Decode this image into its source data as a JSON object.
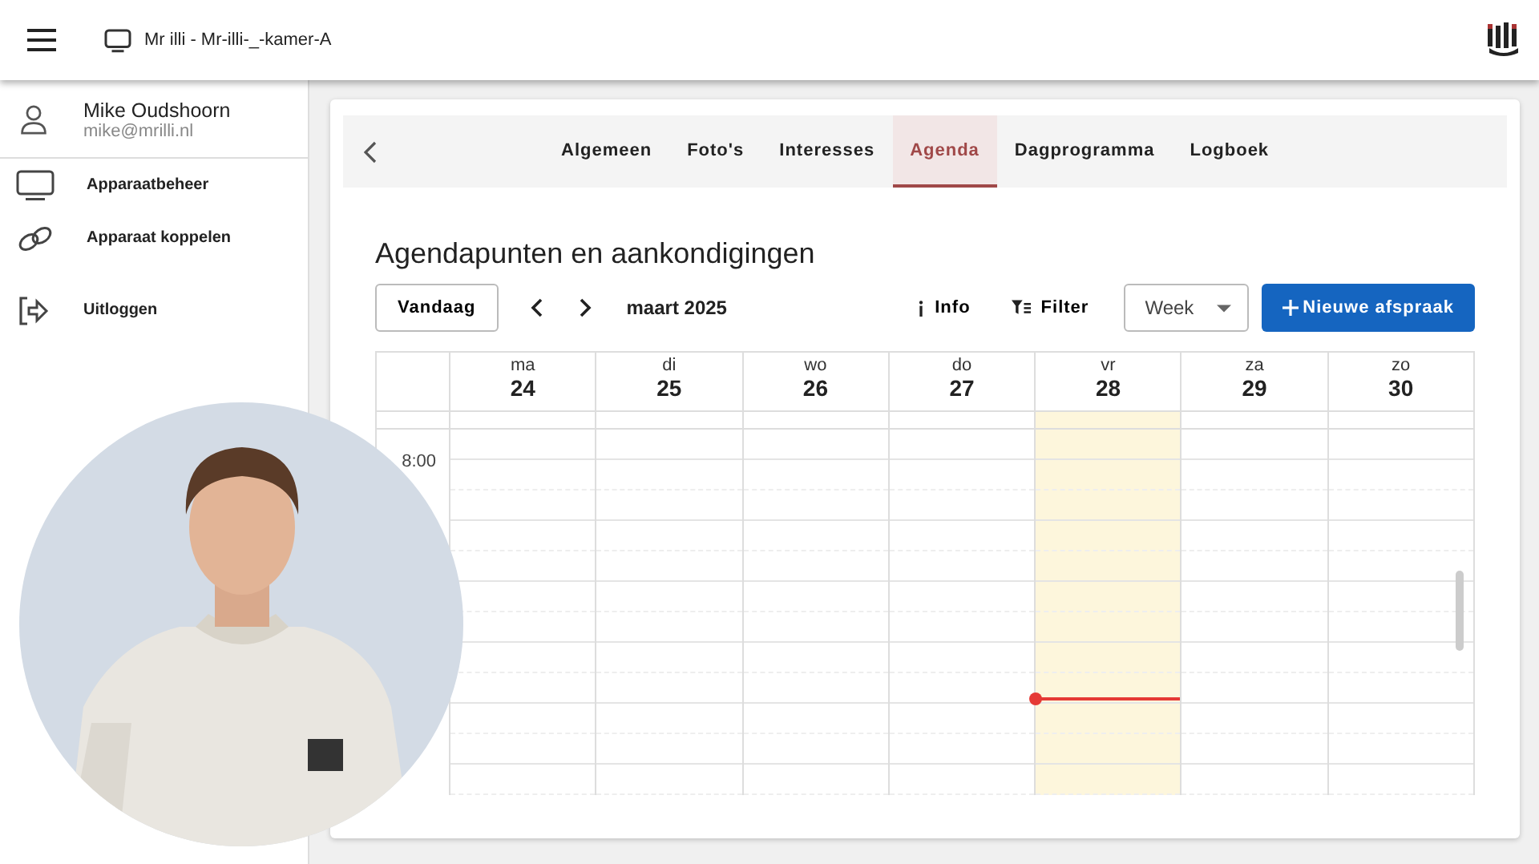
{
  "app_bar": {
    "device": "Mr illi - Mr-illi-_-kamer-A"
  },
  "user": {
    "name": "Mike Oudshoorn",
    "email": "mike@mrilli.nl"
  },
  "sidebar": {
    "items": [
      {
        "label": "Apparaatbeheer",
        "kind": "monitor"
      },
      {
        "label": "Apparaat koppelen",
        "kind": "link"
      },
      {
        "label": "Uitloggen",
        "kind": "logout"
      }
    ]
  },
  "tabs": [
    {
      "label": "Algemeen",
      "selected": false
    },
    {
      "label": "Foto's",
      "selected": false
    },
    {
      "label": "Interesses",
      "selected": false
    },
    {
      "label": "Agenda",
      "selected": true
    },
    {
      "label": "Dagprogramma",
      "selected": false
    },
    {
      "label": "Logboek",
      "selected": false
    }
  ],
  "heading": "Agendapunten en aankondigingen",
  "toolbar": {
    "today_button": "Vandaag",
    "period": "maart 2025",
    "info": "Info",
    "filter": "Filter",
    "view": "Week",
    "new_button": "Nieuwe afspraak"
  },
  "calendar": {
    "days": [
      {
        "weekday": "ma",
        "date": "24",
        "today": false,
        "now_line": false
      },
      {
        "weekday": "di",
        "date": "25",
        "today": false,
        "now_line": false
      },
      {
        "weekday": "wo",
        "date": "26",
        "today": false,
        "now_line": false
      },
      {
        "weekday": "do",
        "date": "27",
        "today": false,
        "now_line": false
      },
      {
        "weekday": "vr",
        "date": "28",
        "today": true,
        "now_line": true
      },
      {
        "weekday": "za",
        "date": "29",
        "today": false,
        "now_line": false
      },
      {
        "weekday": "zo",
        "date": "30",
        "today": false,
        "now_line": false
      }
    ],
    "time_labels": [
      "8:00"
    ]
  }
}
